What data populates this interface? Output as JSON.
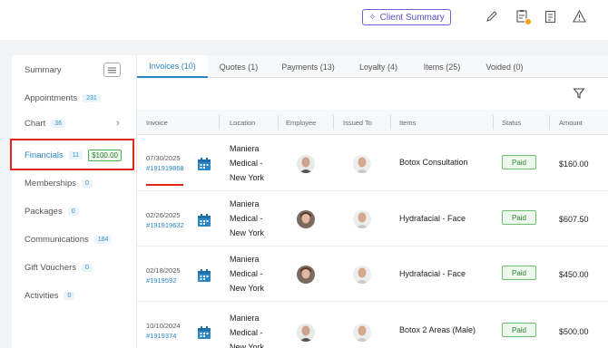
{
  "topbar": {
    "client_summary_label": "Client Summary",
    "icons": [
      "wand-icon",
      "pen-icon",
      "clipboard-alert-icon",
      "note-icon",
      "warning-icon"
    ],
    "accent": "#5b51c8"
  },
  "sidebar": {
    "summary": "Summary",
    "items": [
      {
        "label": "Appointments",
        "count": "231"
      },
      {
        "label": "Chart",
        "count": "36"
      },
      {
        "label": "Financials",
        "count": "11",
        "amount": "$100.00"
      },
      {
        "label": "Memberships",
        "count": "0"
      },
      {
        "label": "Packages",
        "count": "0"
      },
      {
        "label": "Communications",
        "count": "184"
      },
      {
        "label": "Gift Vouchers",
        "count": "0"
      },
      {
        "label": "Activities",
        "count": "0"
      }
    ]
  },
  "tabs": [
    {
      "label": "Invoices (10)"
    },
    {
      "label": "Quotes (1)"
    },
    {
      "label": "Payments (13)"
    },
    {
      "label": "Loyalty (4)"
    },
    {
      "label": "Items (25)"
    },
    {
      "label": "Voided (0)"
    }
  ],
  "table": {
    "columns": [
      "Invoice",
      "Location",
      "Employee",
      "Issued To",
      "Items",
      "Status",
      "Amount"
    ],
    "rows": [
      {
        "date": "07/30/2025",
        "invoice": "#191919868",
        "location": [
          "Maniera",
          "Medical -",
          "New York"
        ],
        "item": "Botox Consultation",
        "status": "Paid",
        "amount": "$160.00"
      },
      {
        "date": "02/26/2025",
        "invoice": "#191919632",
        "location": [
          "Maniera",
          "Medical -",
          "New York"
        ],
        "item": "Hydrafacial - Face",
        "status": "Paid",
        "amount": "$607.50"
      },
      {
        "date": "02/18/2025",
        "invoice": "#1919592",
        "location": [
          "Maniera",
          "Medical -",
          "New York"
        ],
        "item": "Hydrafacial - Face",
        "status": "Paid",
        "amount": "$450.00"
      },
      {
        "date": "10/10/2024",
        "invoice": "#1919374",
        "location": [
          "Maniera",
          "Medical -",
          "New York"
        ],
        "item": "Botox 2 Areas (Male)",
        "status": "Paid",
        "amount": "$500.00"
      }
    ]
  },
  "colors": {
    "link": "#2a86c4",
    "paid": "#2e7d32",
    "highlight": "#e0251b"
  }
}
